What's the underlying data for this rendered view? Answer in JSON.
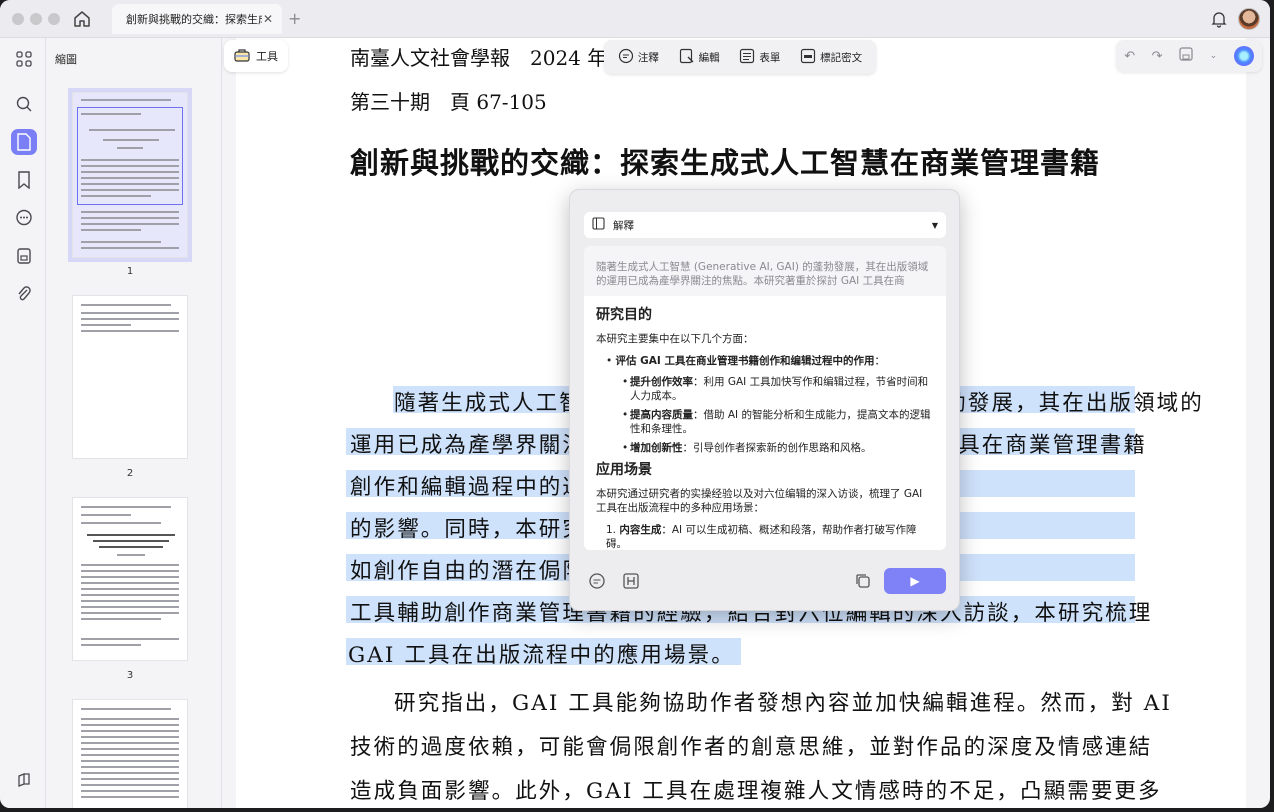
{
  "tab": {
    "title": "創新與挑戰的交織：探索生成式人工智慧在商業管理書籍"
  },
  "thumbnails": {
    "title": "縮圖",
    "pages": [
      "1",
      "2",
      "3"
    ]
  },
  "toolbar": {
    "tools_label": "工具",
    "annotate": "注釋",
    "edit": "編輯",
    "form": "表單",
    "redact": "標記密文"
  },
  "document": {
    "header_line1": "南臺人文社會學報　2024 年",
    "header_line2": "第三十期　頁 67-105",
    "title": "創新與挑戰的交織：探索生成式人工智慧在商業管理書籍",
    "p1_lines": [
      "隨著生成式人工智慧（Generative AI, GAI）的蓬勃發展，其在出版領域的",
      "運用已成為產學界關注的焦點。本研究著重於探討 GAI 工具在商業管理書籍",
      "創作和編輯過程中的運用，以及其對內容品質以及創新性",
      "的影響。同時，本研究亦探討在此過程中可能遭遇的挑戰，",
      "如創作自由的潛在侷限等。本研究透過研究者利用 GAI",
      "工具輔助創作商業管理書籍的經驗，結合對六位編輯的深入訪談，本研究梳理",
      "GAI 工具在出版流程中的應用場景。"
    ],
    "p2_lines": [
      "研究指出，GAI 工具能夠協助作者發想內容並加快編輯進程。然而，對 AI",
      "技術的過度依賴，可能會侷限創作者的創意思維，並對作品的深度及情感連結",
      "造成負面影響。此外，GAI 工具在處理複雜人文情感時的不足，凸顯需要更多"
    ]
  },
  "ai_panel": {
    "mode": "解釋",
    "source_text": "隨著生成式人工智慧 (Generative AI, GAI) 的蓬勃發展，其在出版領域的運用已成為產學界關注的焦點。本研究著重於探討 GAI 工具在商",
    "heading1": "研究目的",
    "intro": "本研究主要集中在以下几个方面：",
    "bullet1_bold": "评估 GAI 工具在商业管理书籍创作和编辑过程中的作用",
    "bullet1_rest": "：",
    "sub1_bold": "提升创作效率",
    "sub1_rest": "：利用 GAI 工具加快写作和编辑过程，节省时间和人力成本。",
    "sub2_bold": "提高内容质量",
    "sub2_rest": "：借助 AI 的智能分析和生成能力，提高文本的逻辑性和条理性。",
    "sub3_bold": "增加创新性",
    "sub3_rest": "：引导创作者探索新的创作思路和风格。",
    "heading2": "应用场景",
    "intro2": "本研究通过研究者的实操经验以及对六位编辑的深入访谈，梳理了 GAI 工具在出版流程中的多种应用场景：",
    "item1_bold": "内容生成",
    "item1_rest": "：AI 可以生成初稿、概述和段落，帮助作者打破写作障碍。"
  },
  "colors": {
    "accent": "#7b7ff6",
    "highlight": "#cfe2fb"
  }
}
